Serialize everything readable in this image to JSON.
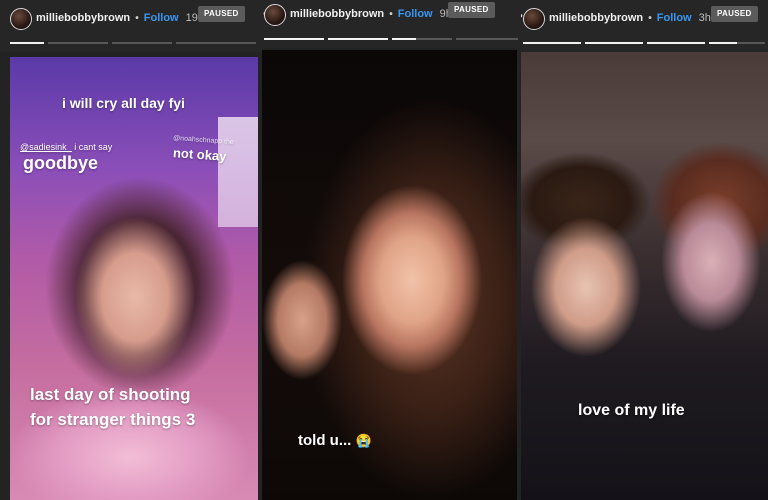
{
  "stories": [
    {
      "username": "milliebobbybrown",
      "separator": "•",
      "follow_label": "Follow",
      "time": "19h",
      "paused_label": "PAUSED",
      "progress_segments": [
        1,
        0,
        0,
        0
      ],
      "captions": {
        "top": "i will cry all day fyi",
        "mention": "@sadiesink_",
        "mention_tail": "i cant say",
        "goodbye": "goodbye",
        "mention2": "@noahschnapp the",
        "not_okay": "not okay",
        "bottom1": "last day of shooting",
        "bottom2": "for stranger things 3"
      }
    },
    {
      "username": "milliebobbybrown",
      "separator": "•",
      "follow_label": "Follow",
      "time": "9h",
      "paused_label": "PAUSED",
      "progress_segments": [
        1,
        1,
        0.4,
        0
      ],
      "captions": {
        "caption": "told u...",
        "emoji": "😭"
      }
    },
    {
      "username": "milliebobbybrown",
      "separator": "•",
      "follow_label": "Follow",
      "time": "3h",
      "paused_label": "PAUSED",
      "progress_segments": [
        1,
        1,
        1,
        0.5
      ],
      "captions": {
        "caption": "love of my life"
      }
    }
  ],
  "more_icon": "more-dots-icon"
}
